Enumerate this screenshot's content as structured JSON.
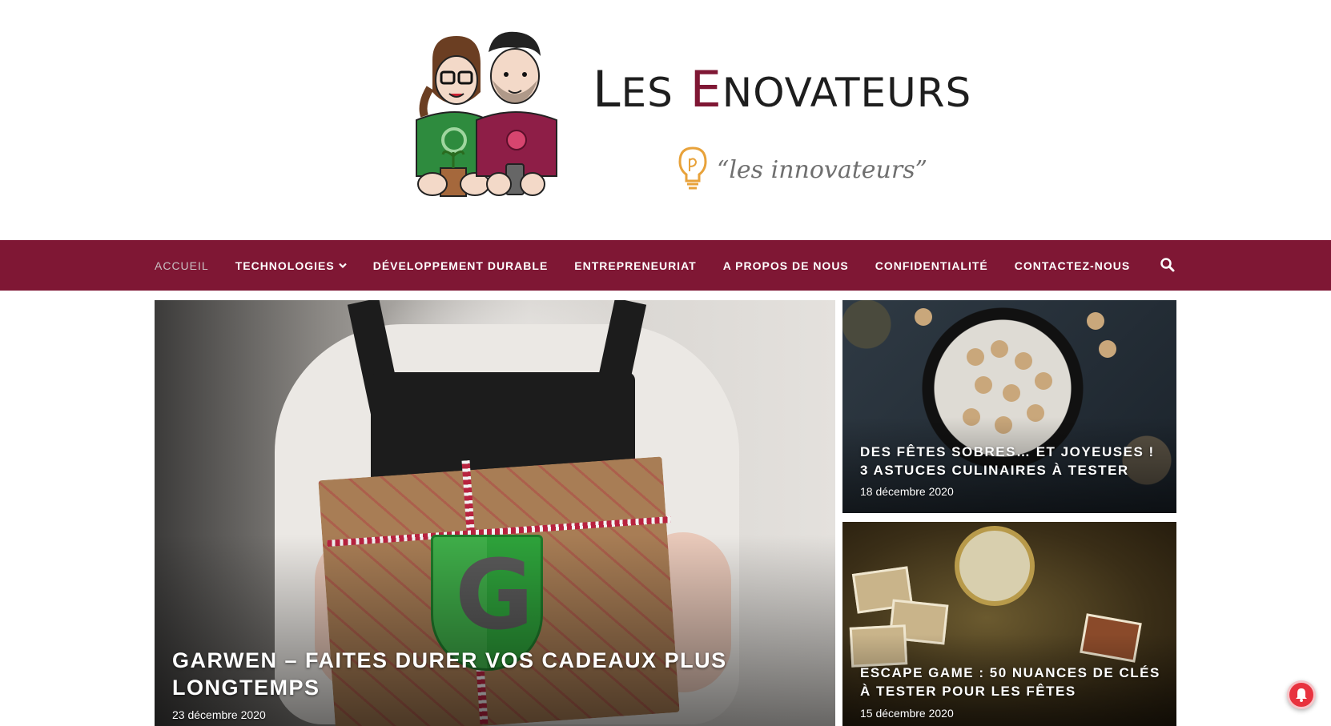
{
  "logo": {
    "title_first": "L",
    "title_first_rest": "ES",
    "title_e": "E",
    "title_rest": "NOVATEURS",
    "tagline": "“les innovateurs”"
  },
  "nav": {
    "items": [
      {
        "label": "ACCUEIL",
        "active": true
      },
      {
        "label": "TECHNOLOGIES",
        "has_dropdown": true
      },
      {
        "label": "DÉVELOPPEMENT DURABLE"
      },
      {
        "label": "ENTREPRENEURIAT"
      },
      {
        "label": "A PROPOS DE NOUS"
      },
      {
        "label": "CONFIDENTIALITÉ"
      },
      {
        "label": "CONTACTEZ-NOUS"
      }
    ],
    "search_icon": "search-icon"
  },
  "posts": {
    "main": {
      "title": "GARWEN – FAITES DURER VOS CADEAUX PLUS LONGTEMPS",
      "date": "23 décembre 2020",
      "shield_letter": "G"
    },
    "top": {
      "title": "DES FÊTES SOBRES… ET JOYEUSES ! 3 ASTUCES CULINAIRES À TESTER",
      "date": "18 décembre 2020"
    },
    "bottom": {
      "title": "ESCAPE GAME : 50 NUANCES DE CLÉS À TESTER POUR LES FÊTES",
      "date": "15 décembre 2020"
    }
  },
  "colors": {
    "brand": "#7f1734",
    "nav_text": "#ffffff",
    "nav_active": "#c9c0c3",
    "notification": "#e8333f"
  }
}
